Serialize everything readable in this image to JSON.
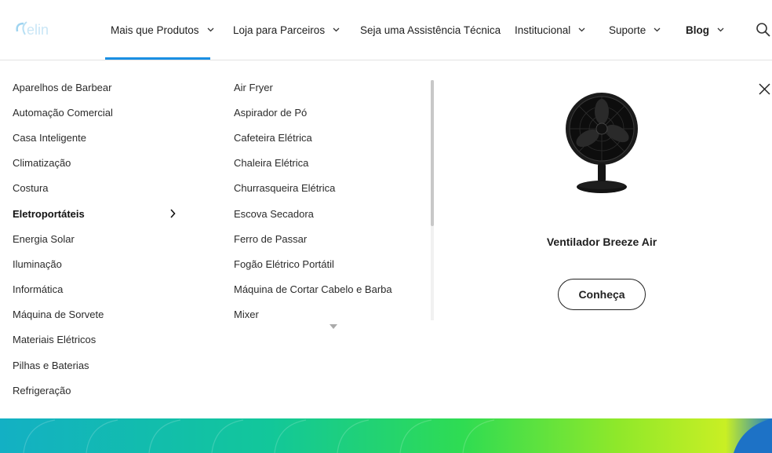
{
  "header": {
    "logo_alt": "elgin",
    "nav": [
      {
        "label": "Mais que Produtos",
        "has_dropdown": true,
        "active": true
      },
      {
        "label": "Loja para Parceiros",
        "has_dropdown": true
      },
      {
        "label": "Seja uma Assistência Técnica",
        "has_dropdown": false
      },
      {
        "label": "Institucional",
        "has_dropdown": true
      },
      {
        "label": "Suporte",
        "has_dropdown": true
      },
      {
        "label": "Blog",
        "has_dropdown": true
      }
    ],
    "search_icon": "search-icon"
  },
  "menu": {
    "categories": [
      {
        "label": "Aparelhos de Barbear"
      },
      {
        "label": "Automação Comercial"
      },
      {
        "label": "Casa Inteligente"
      },
      {
        "label": "Climatização"
      },
      {
        "label": "Costura"
      },
      {
        "label": "Eletroportáteis",
        "active": true
      },
      {
        "label": "Energia Solar"
      },
      {
        "label": "Iluminação"
      },
      {
        "label": "Informática"
      },
      {
        "label": "Máquina de Sorvete"
      },
      {
        "label": "Materiais Elétricos"
      },
      {
        "label": "Pilhas e Baterias"
      },
      {
        "label": "Refrigeração"
      }
    ],
    "subcategories": [
      {
        "label": "Air Fryer"
      },
      {
        "label": "Aspirador de Pó"
      },
      {
        "label": "Cafeteira Elétrica"
      },
      {
        "label": "Chaleira Elétrica"
      },
      {
        "label": "Churrasqueira Elétrica"
      },
      {
        "label": "Escova Secadora"
      },
      {
        "label": "Ferro de Passar"
      },
      {
        "label": "Fogão Elétrico Portátil"
      },
      {
        "label": "Máquina de Cortar Cabelo e Barba"
      },
      {
        "label": "Mixer"
      }
    ],
    "featured": {
      "title": "Ventilador Breeze Air",
      "cta_label": "Conheça"
    }
  },
  "colors": {
    "accent": "#1a8fe3",
    "text": "#222222",
    "banner_gradient": [
      "#0fb3c8",
      "#17d07a",
      "#6ee51f",
      "#b7ef1a",
      "#1e73c8"
    ]
  }
}
